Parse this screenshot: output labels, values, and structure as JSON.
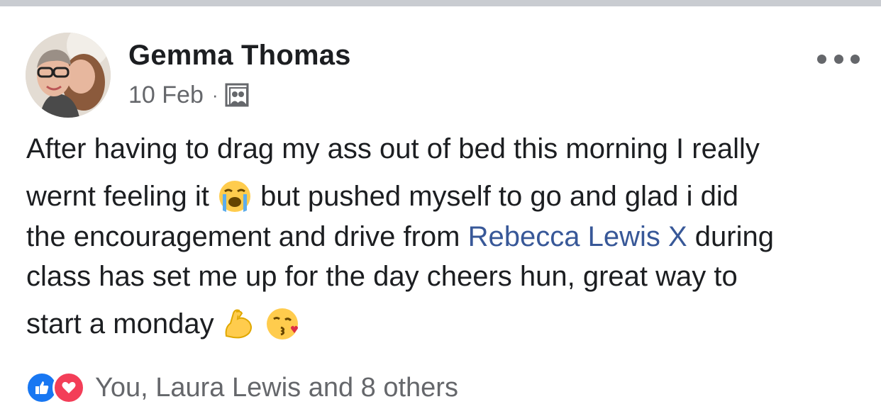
{
  "post": {
    "author": "Gemma Thomas",
    "date": "10 Feb",
    "separator": "·",
    "audience_icon": "photo-album-icon",
    "more_icon": "more-dots-icon",
    "text_lines": [
      "After having to drag my ass out of bed this morning I really",
      "wernt feeling it",
      "but pushed myself to go and glad i did",
      "the encouragement and drive from",
      "Rebecca Lewis X",
      "during",
      "class has set me up for the day cheers hun,  great way to",
      "start a monday"
    ],
    "emojis": [
      "loudly-crying-face",
      "flexed-biceps",
      "face-blowing-kiss"
    ],
    "reactions": {
      "icons": [
        "like-icon",
        "love-icon"
      ],
      "summary": "You, Laura Lewis and 8 others"
    }
  },
  "colors": {
    "text": "#1c1e21",
    "secondary": "#65676b",
    "link": "#385898",
    "like": "#1877f2",
    "love": "#f33e58"
  }
}
